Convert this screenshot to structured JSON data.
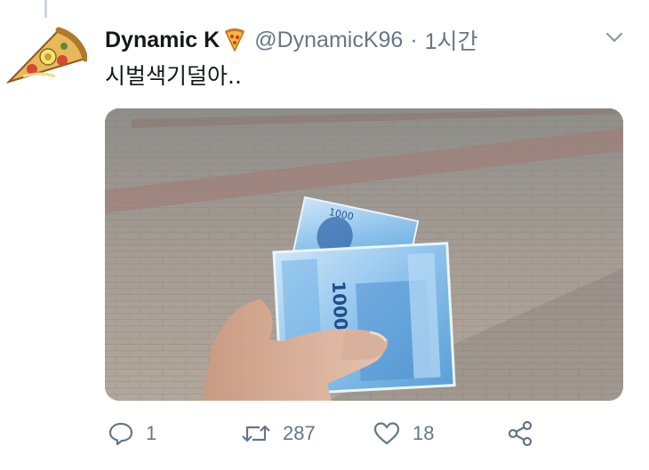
{
  "tweet": {
    "author": {
      "display_name": "Dynamic K",
      "name_emoji_icon": "pizza-icon",
      "handle": "@DynamicK96",
      "avatar_icon": "pizza-slice-avatar"
    },
    "separator": "·",
    "time": "1시간",
    "text": "시벌색기덜아..",
    "media": {
      "description_icon": "photo-banknotes-in-hand"
    },
    "actions": {
      "reply": {
        "icon": "reply-icon",
        "count": "1"
      },
      "retweet": {
        "icon": "retweet-icon",
        "count": "287"
      },
      "like": {
        "icon": "heart-icon",
        "count": "18"
      },
      "share": {
        "icon": "share-icon"
      }
    }
  },
  "colors": {
    "text_primary": "#14171a",
    "text_secondary": "#657786",
    "banknote_blue": "#7fb8e6"
  }
}
